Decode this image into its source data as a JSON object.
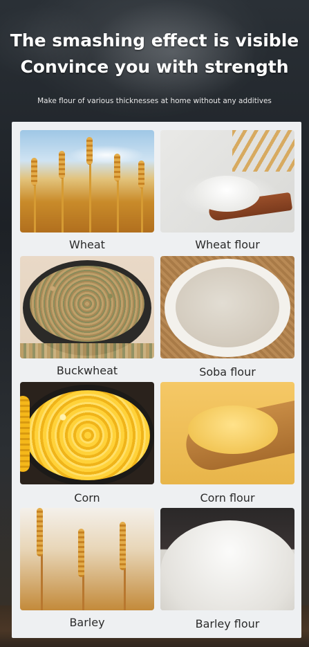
{
  "header": {
    "title_line1": "The smashing effect is visible",
    "title_line2": "Convince you with strength",
    "subtitle": "Make flour of various thicknesses at home without any additives"
  },
  "grid": [
    {
      "left_label": "Wheat",
      "right_label": "Wheat flour"
    },
    {
      "left_label": "Buckwheat",
      "right_label": "Soba flour"
    },
    {
      "left_label": "Corn",
      "right_label": "Corn flour"
    },
    {
      "left_label": "Barley",
      "right_label": "Barley flour"
    }
  ],
  "colors": {
    "panel_bg": "#eef0f2",
    "headline_text": "#ffffff",
    "caption_text": "#2a2a2a"
  }
}
